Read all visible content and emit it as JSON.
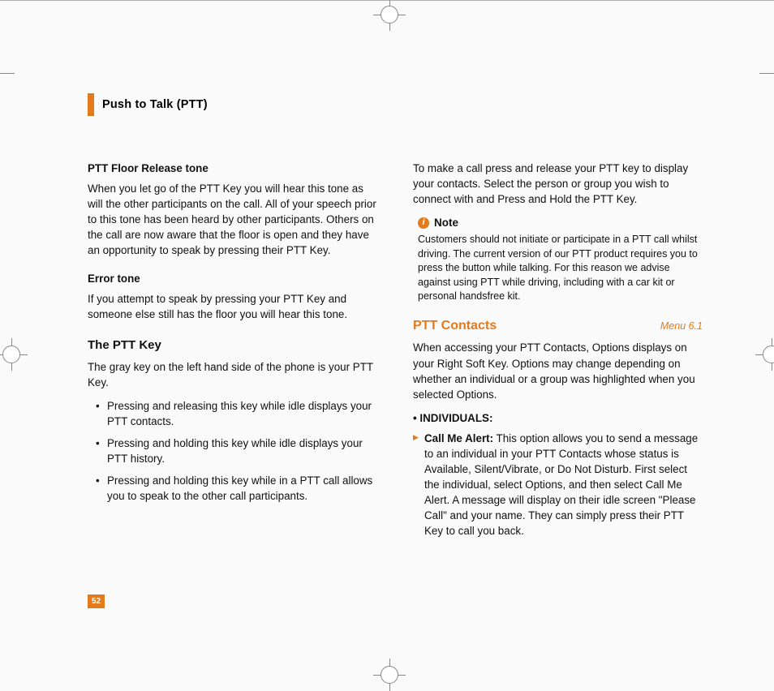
{
  "header": {
    "title": "Push to Talk (PTT)"
  },
  "left": {
    "sub1": "PTT Floor Release tone",
    "p1": "When you let go of the PTT Key you will hear this tone as will the other participants on the call. All of your speech prior to this tone has been heard by other participants. Others on the call are now aware that the floor is open and they have an opportunity to speak by pressing their PTT Key.",
    "sub2": "Error tone",
    "p2": "If you attempt to speak by pressing your PTT Key and someone else still has the floor you will hear this tone.",
    "h2": "The PTT Key",
    "p3": "The gray key on the left hand side of the phone is your PTT Key.",
    "b1": "Pressing and releasing this key while idle displays your PTT contacts.",
    "b2": "Pressing and holding this key while idle displays your PTT history.",
    "b3": "Pressing and holding this key while in a PTT call allows you to speak to the other call participants."
  },
  "right": {
    "p1": "To make a call press and release your PTT key to display your contacts. Select the person or group you wish to connect with and Press and Hold the PTT Key.",
    "note_label": "Note",
    "note_text": "Customers should not initiate or participate in a PTT call whilst driving. The current version of our PTT product requires you to press the button while talking. For this reason we advise against using PTT while driving, including with a car kit or personal handsfree kit.",
    "section_title": "PTT Contacts",
    "menu_ref": "Menu 6.1",
    "p2": "When accessing your PTT Contacts, Options displays on your Right Soft Key. Options may change depending on whether an individual or a group was highlighted when you selected Options.",
    "sub3": "• INDIVIDUALS:",
    "item1_bold": "Call Me Alert:",
    "item1_rest": " This option allows you to send a message to an individual in your PTT Contacts whose status is Available, Silent/Vibrate, or Do Not Disturb. First select the individual, select Options, and then select Call Me Alert. A message will display on their idle screen \"Please Call\" and your name. They can simply press their PTT Key to call you back."
  },
  "page_number": "52"
}
